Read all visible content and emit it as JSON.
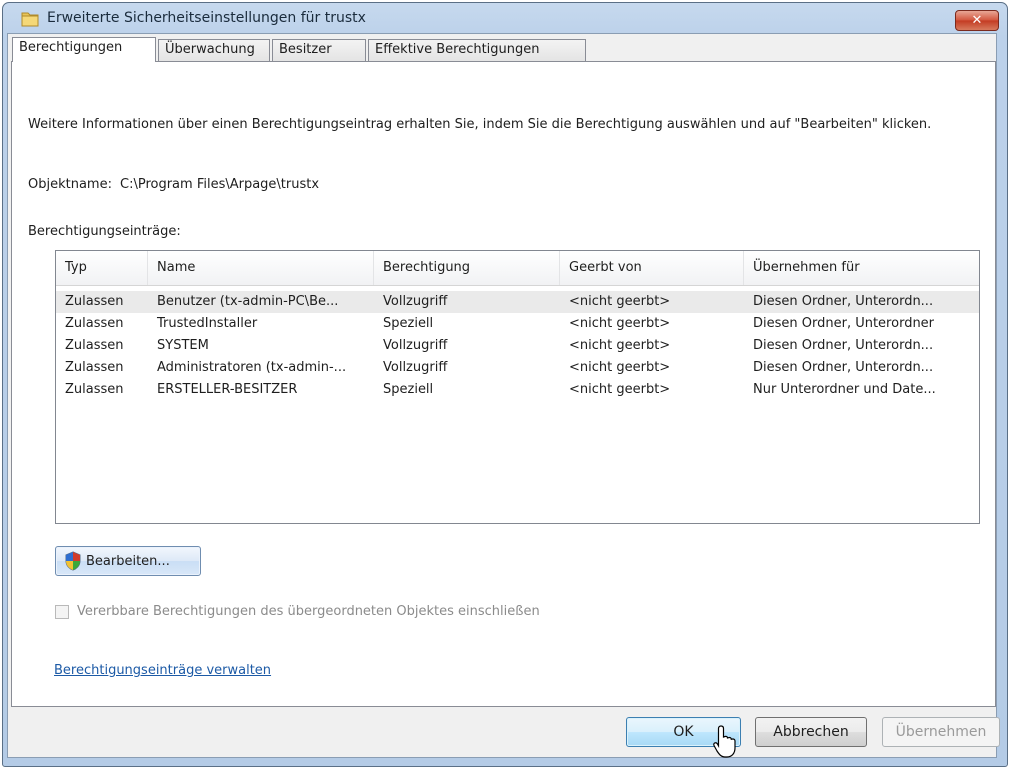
{
  "window": {
    "title": "Erweiterte Sicherheitseinstellungen für trustx",
    "close_label": "✕"
  },
  "tabs": [
    {
      "label": "Berechtigungen",
      "active": true
    },
    {
      "label": "Überwachung",
      "active": false
    },
    {
      "label": "Besitzer",
      "active": false
    },
    {
      "label": "Effektive Berechtigungen",
      "active": false
    }
  ],
  "panel": {
    "info_text": "Weitere Informationen über einen Berechtigungseintrag erhalten Sie, indem Sie die Berechtigung auswählen und auf \"Bearbeiten\" klicken.",
    "object_label": "Objektname:",
    "object_value": "C:\\Program Files\\Arpage\\trustx",
    "entries_label": "Berechtigungseinträge:"
  },
  "table": {
    "columns": [
      "Typ",
      "Name",
      "Berechtigung",
      "Geerbt von",
      "Übernehmen für"
    ],
    "rows": [
      [
        "Zulassen",
        "Benutzer (tx-admin-PC\\Be...",
        "Vollzugriff",
        "<nicht geerbt>",
        "Diesen Ordner, Unterordn..."
      ],
      [
        "Zulassen",
        "TrustedInstaller",
        "Speziell",
        "<nicht geerbt>",
        "Diesen Ordner, Unterordner"
      ],
      [
        "Zulassen",
        "SYSTEM",
        "Vollzugriff",
        "<nicht geerbt>",
        "Diesen Ordner, Unterordn..."
      ],
      [
        "Zulassen",
        "Administratoren (tx-admin-...",
        "Vollzugriff",
        "<nicht geerbt>",
        "Diesen Ordner, Unterordn..."
      ],
      [
        "Zulassen",
        "ERSTELLER-BESITZER",
        "Speziell",
        "<nicht geerbt>",
        "Nur Unterordner und Date..."
      ]
    ],
    "selected_row": 0
  },
  "actions": {
    "edit_label": "Bearbeiten...",
    "inherit_checkbox_label": "Vererbbare Berechtigungen des übergeordneten Objektes einschließen",
    "inherit_checked": false,
    "manage_link": "Berechtigungseinträge verwalten"
  },
  "footer": {
    "ok_label": "OK",
    "cancel_label": "Abbrechen",
    "apply_label": "Übernehmen"
  },
  "colors": {
    "frame": "#bcd1ea",
    "link": "#1c5aa6",
    "close": "#c33b22"
  }
}
